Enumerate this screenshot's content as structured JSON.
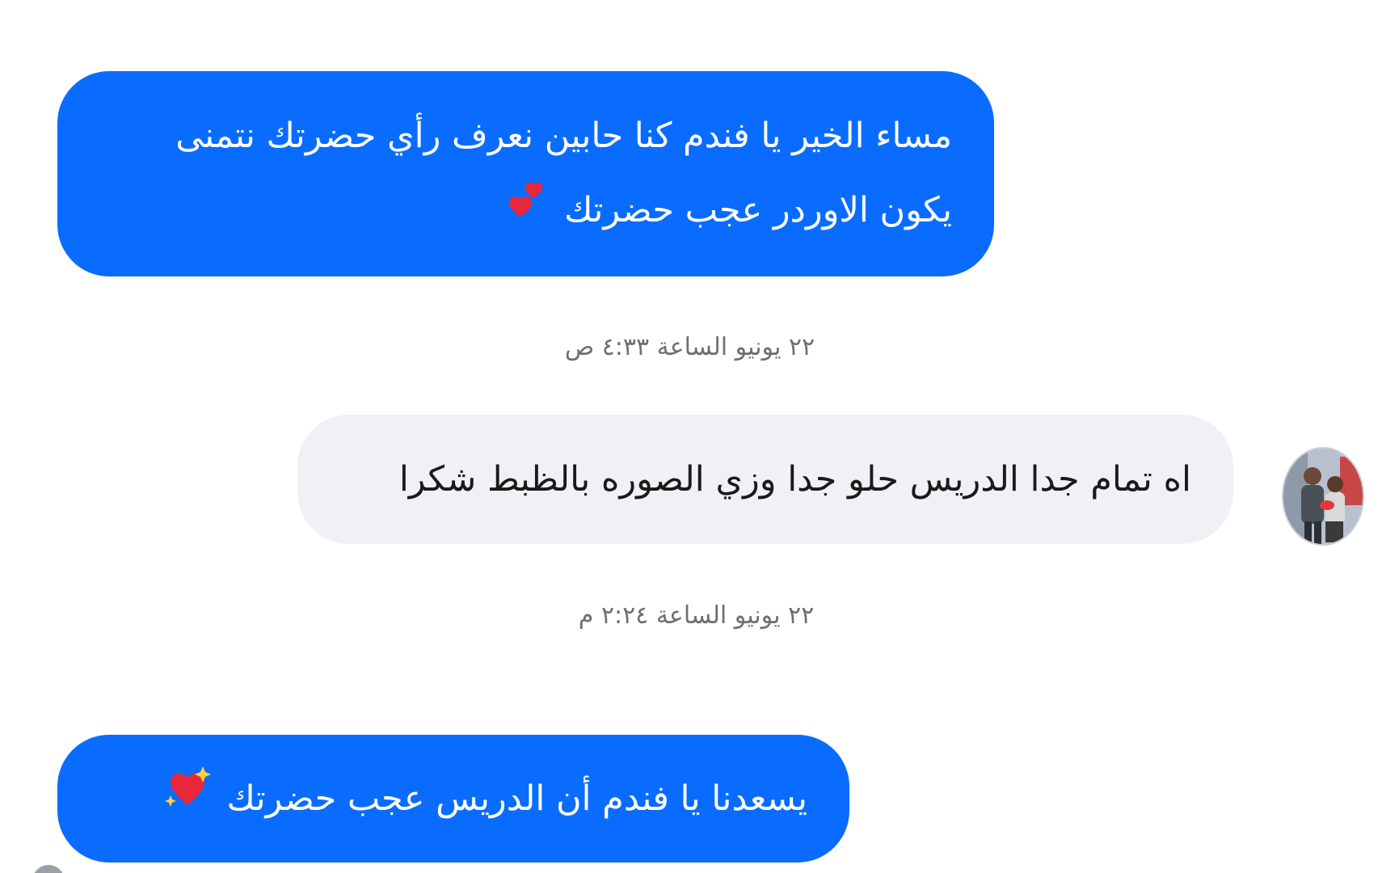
{
  "messages": [
    {
      "direction": "sent",
      "lines": [
        "مساء الخير يا فندم كنا حابين نعرف رأي حضرتك نتمنى",
        "يكون الاوردر عجب حضرتك"
      ],
      "emoji": "two-hearts-icon"
    },
    {
      "direction": "received",
      "text": "اه تمام جدا الدريس حلو جدا وزي الصوره بالظبط شكرا"
    },
    {
      "direction": "sent",
      "text": "يسعدنا يا فندم أن الدريس عجب حضرتك",
      "emoji": "sparkling-heart-icon"
    }
  ],
  "timestamps": [
    "٢٢ يونيو الساعة ٤:٣٣ ص",
    "٢٢ يونيو الساعة ٢:٢٤ م"
  ],
  "colors": {
    "sent_bubble": "#0a6cff",
    "received_bubble": "#f0f1f4",
    "timestamp_text": "#6e6e73",
    "heart": "#e8273b"
  }
}
